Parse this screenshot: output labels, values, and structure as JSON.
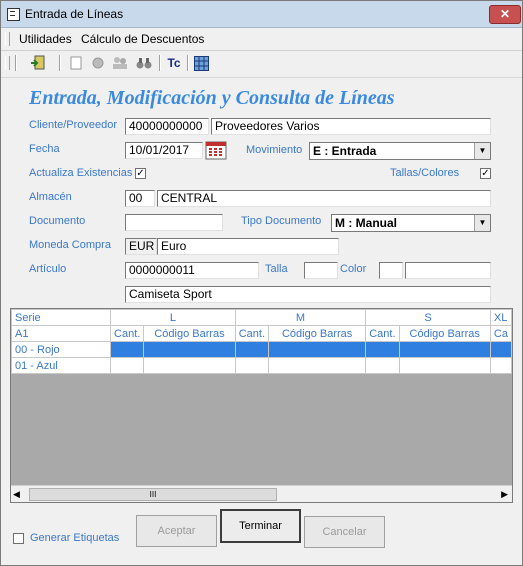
{
  "window": {
    "title": "Entrada de Líneas",
    "close_glyph": "✕"
  },
  "menu": {
    "items": [
      {
        "label": "Utilidades"
      },
      {
        "label": "Cálculo de Descuentos"
      }
    ]
  },
  "toolbar": {
    "icons": [
      "exit-icon",
      "new-doc-icon",
      "paint-icon",
      "people-icon",
      "binoculars-icon",
      "tc-icon",
      "grid-icon"
    ],
    "tc_label": "Tc"
  },
  "form": {
    "heading": "Entrada, Modificación y Consulta de Líneas",
    "cliente_label": "Cliente/Proveedor",
    "cliente_code": "40000000000",
    "cliente_name": "Proveedores Varios",
    "fecha_label": "Fecha",
    "fecha_value": "10/01/2017",
    "movimiento_label": "Movimiento",
    "movimiento_value": "E : Entrada",
    "actualiza_label": "Actualiza Existencias",
    "tallas_label": "Tallas/Colores",
    "almacen_label": "Almacén",
    "almacen_code": "00",
    "almacen_name": "CENTRAL",
    "documento_label": "Documento",
    "documento_value": "",
    "tipo_doc_label": "Tipo Documento",
    "tipo_doc_value": "M : Manual",
    "moneda_label": "Moneda Compra",
    "moneda_code": "EUR",
    "moneda_name": "Euro",
    "articulo_label": "Artículo",
    "articulo_code": "0000000011",
    "talla_label": "Talla",
    "talla_value": "",
    "color_label": "Color",
    "color_code": "",
    "color_name": "",
    "articulo_desc": "Camiseta Sport"
  },
  "grid": {
    "serie_label": "Serie",
    "serie_value": "A1",
    "sizes": [
      "L",
      "M",
      "S",
      "XL"
    ],
    "cant_label": "Cant.",
    "codigo_label": "Código Barras",
    "ca_label": "Ca",
    "rows": [
      {
        "label": "00 - Rojo"
      },
      {
        "label": "01 - Azul"
      }
    ],
    "scroll_thumb": "III"
  },
  "footer": {
    "generar_label": "Generar Etiquetas",
    "aceptar_label": "Aceptar",
    "terminar_label": "Terminar",
    "cancelar_label": "Cancelar"
  },
  "colors": {
    "label_blue": "#3a78c8",
    "heading_blue": "#3a8ae0",
    "selection": "#2f7fe0"
  }
}
